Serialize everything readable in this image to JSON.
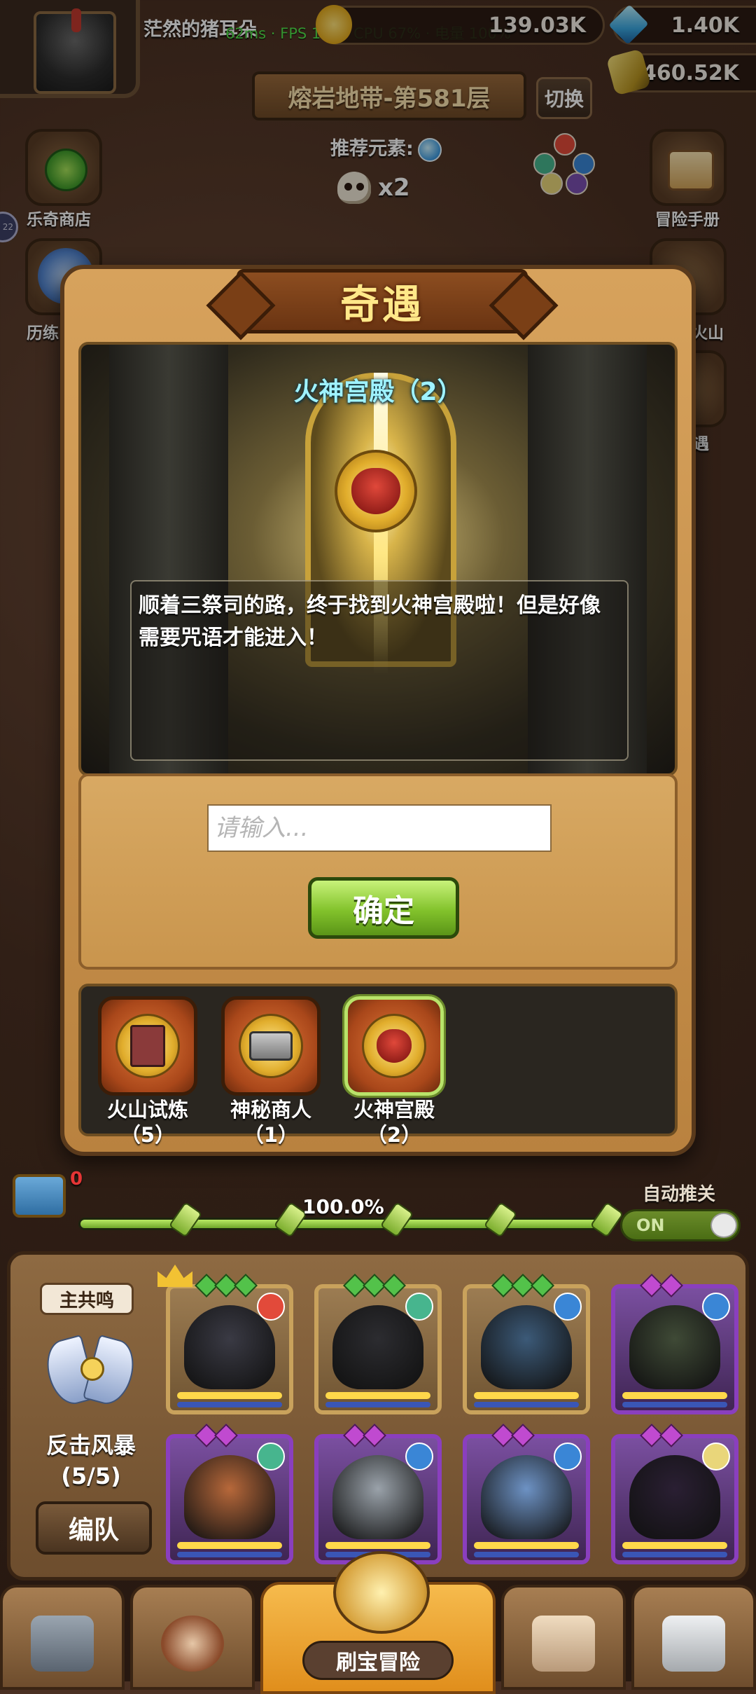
{
  "hud": {
    "username": "茫然的猪耳朵",
    "perf_text": "62ms · FPS 111 · CPU 67% · 电量 100%",
    "gold": "139.03K",
    "gems": "1.40K",
    "ore": "460.52K"
  },
  "stage": {
    "floor_label": "熔岩地带-第581层",
    "switch_label": "切换",
    "recommend_label": "推荐元素:",
    "multiplier": "x2"
  },
  "side_left": {
    "shop_label": "乐奇商店",
    "trial_label": "历练",
    "edge_badge": "22"
  },
  "side_right": {
    "manual_label": "冒险手册",
    "volcano_label": "火山",
    "encounter_label": "遇"
  },
  "modal": {
    "title": "奇遇",
    "event_title": "火神宫殿（2）",
    "description": "顺着三祭司的路，终于找到火神宫殿啦！但是好像需要咒语才能进入！",
    "input_placeholder": "请输入...",
    "confirm_label": "确定",
    "events": [
      {
        "name": "火山试炼",
        "count": "（5）",
        "icon": "book-emblem-icon"
      },
      {
        "name": "神秘商人",
        "count": "（1）",
        "icon": "merchant-emblem-icon"
      },
      {
        "name": "火神宫殿",
        "count": "（2）",
        "icon": "fire-god-emblem-icon",
        "selected": true
      }
    ]
  },
  "progress": {
    "chest_count": "0",
    "percent_text": "100.0%",
    "fraction": 1.0,
    "auto_label": "自动推关",
    "toggle_label": "ON"
  },
  "team": {
    "leader_tag": "主共鸣",
    "skill_name": "反击风暴",
    "skill_count": "(5/5)",
    "formation_label": "编队",
    "heroes": [
      {
        "rarity": "gold",
        "element": "fire",
        "portrait_color": "#3a3a44"
      },
      {
        "rarity": "gold",
        "element": "wind",
        "portrait_color": "#2c2c30"
      },
      {
        "rarity": "gold",
        "element": "water",
        "portrait_color": "#3c5a78"
      },
      {
        "rarity": "purple",
        "element": "water",
        "portrait_color": "#3f4a36"
      },
      {
        "rarity": "purple",
        "element": "wind",
        "portrait_color": "#b7683a"
      },
      {
        "rarity": "purple",
        "element": "water",
        "portrait_color": "#9aa2aa"
      },
      {
        "rarity": "purple",
        "element": "water",
        "portrait_color": "#6d92c4"
      },
      {
        "rarity": "purple",
        "element": "light",
        "portrait_color": "#2a1f33"
      }
    ]
  },
  "nav": {
    "main_label": "刷宝冒险",
    "items": [
      "shop-icon",
      "hero-icon",
      "treasure-adventure-icon",
      "bag-icon",
      "forge-icon"
    ]
  },
  "colors": {
    "confirm_green": "#82c22b",
    "title_gold": "#ffe889",
    "event_title_cyan": "#9ff2ff",
    "perf_green": "#54e14a",
    "badge_red": "#e53535"
  }
}
